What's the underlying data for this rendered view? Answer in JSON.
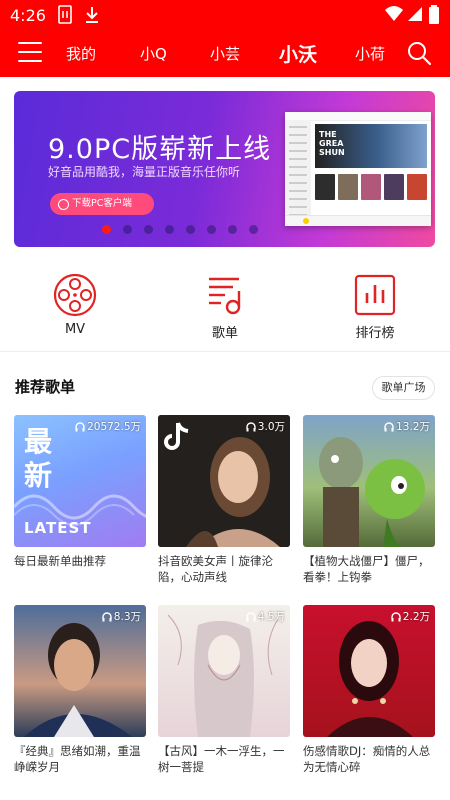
{
  "status_bar": {
    "time": "4:26",
    "icons": [
      "sim-icon",
      "download-icon",
      "wifi-icon",
      "signal-icon",
      "battery-icon"
    ]
  },
  "nav": {
    "tabs": [
      {
        "label": "我的",
        "active": false
      },
      {
        "label": "小Q",
        "active": false
      },
      {
        "label": "小芸",
        "active": false
      },
      {
        "label": "小沃",
        "active": true
      },
      {
        "label": "小荷",
        "active": false
      }
    ]
  },
  "banner": {
    "title": "9.0PC版崭新上线",
    "subtitle": "好音品用酷我，海量正版音乐任你听",
    "download_label": "下载PC客户端",
    "page_count": 8,
    "active_index": 0
  },
  "entries": [
    {
      "label": "MV",
      "icon": "film-reel-icon"
    },
    {
      "label": "歌单",
      "icon": "playlist-icon"
    },
    {
      "label": "排行榜",
      "icon": "ranking-chart-icon"
    }
  ],
  "section": {
    "title": "推荐歌单",
    "square_label": "歌单广场"
  },
  "playlists": [
    {
      "plays": "20572.5万",
      "name": "每日最新单曲推荐",
      "cover_text": [
        "最",
        "新"
      ],
      "cover_tag": "LATEST"
    },
    {
      "plays": "3.0万",
      "name": "抖音欧美女声丨旋律沦陷，心动声线"
    },
    {
      "plays": "13.2万",
      "name": "【植物大战僵尸】僵尸，看拳！上钩拳"
    },
    {
      "plays": "8.3万",
      "name": "『经典』思绪如潮，重温峥嵘岁月"
    },
    {
      "plays": "4.5万",
      "name": "【古风】一木一浮生，一树一菩提"
    },
    {
      "plays": "2.2万",
      "name": "伤感情歌DJ：痴情的人总为无情心碎"
    }
  ],
  "colors": {
    "brand_red": "#ff0000",
    "banner_purple": "#6a2ed8",
    "icon_red": "#e02424"
  }
}
